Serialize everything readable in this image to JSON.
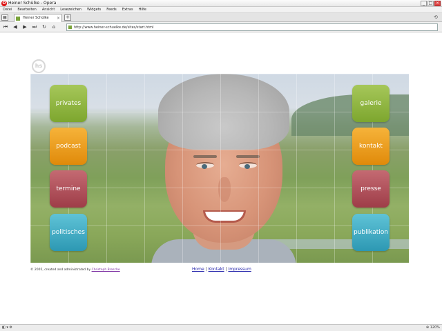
{
  "window": {
    "title": "Heiner Schülke - Opera"
  },
  "menu": [
    "Datei",
    "Bearbeiten",
    "Ansicht",
    "Lesezeichen",
    "Widgets",
    "Feeds",
    "Extras",
    "Hilfe"
  ],
  "tab": {
    "label": "Heiner Schülke"
  },
  "address": {
    "url": "http://www.heiner-schuelke.de/sites/start.html"
  },
  "site": {
    "logo_text": "hs",
    "left_buttons": [
      "privates",
      "podcast",
      "termine",
      "politisches"
    ],
    "right_buttons": [
      "galerie",
      "kontakt",
      "presse",
      "publikation"
    ],
    "colors": {
      "green": "#8cb53e",
      "orange": "#eba020",
      "red": "#ad4f58",
      "teal": "#3eaac3"
    }
  },
  "footer": {
    "copyright_prefix": "© 2005, created and administrated by",
    "author": "Christoph Brosche",
    "links": [
      "Home",
      "Kontakt",
      "Impressum"
    ],
    "sep": "|"
  },
  "status": {
    "zoom": "120%"
  }
}
